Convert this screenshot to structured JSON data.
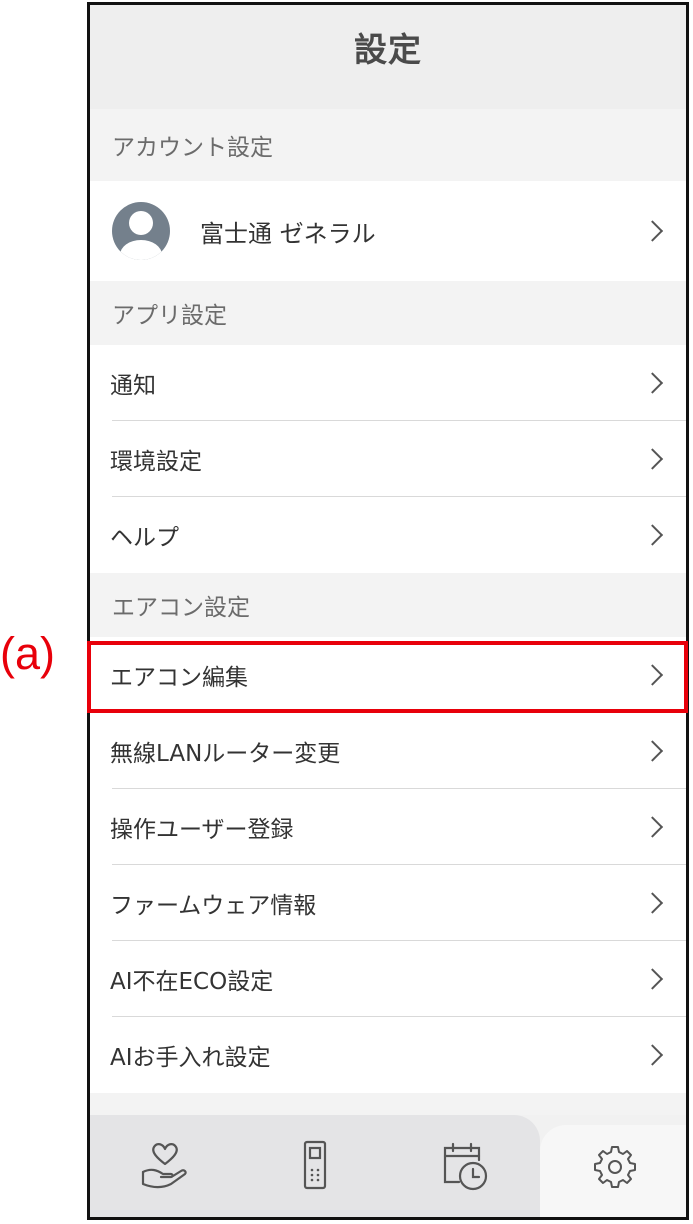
{
  "header": {
    "title": "設定"
  },
  "account_section": {
    "label": "アカウント設定",
    "user_name": "富士通 ゼネラル"
  },
  "app_section": {
    "label": "アプリ設定",
    "items": [
      {
        "label": "通知"
      },
      {
        "label": "環境設定"
      },
      {
        "label": "ヘルプ"
      }
    ]
  },
  "ac_section": {
    "label": "エアコン設定",
    "items": [
      {
        "label": "エアコン編集"
      },
      {
        "label": "無線LANルーター変更"
      },
      {
        "label": "操作ユーザー登録"
      },
      {
        "label": "ファームウェア情報"
      },
      {
        "label": "AI不在ECO設定"
      },
      {
        "label": "AIお手入れ設定"
      }
    ]
  },
  "tabbar": {
    "tabs": [
      {
        "icon": "heart-hand-icon"
      },
      {
        "icon": "remote-control-icon"
      },
      {
        "icon": "calendar-clock-icon"
      },
      {
        "icon": "gear-icon",
        "active": true
      }
    ]
  },
  "annotation": {
    "label": "(a)",
    "color": "#e8000a"
  }
}
